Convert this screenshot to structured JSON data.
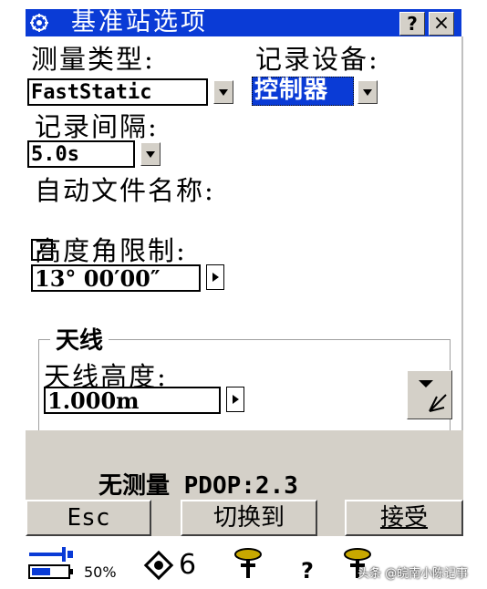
{
  "window": {
    "title": "基准站选项",
    "help_label": "?",
    "close_label": "×"
  },
  "form": {
    "survey_type_label": "测量类型:",
    "survey_type_value": "FastStatic",
    "record_device_label": "记录设备:",
    "record_device_value": "控制器",
    "record_interval_label": "记录间隔:",
    "record_interval_value": "5.0s",
    "auto_filename_label": "自动文件名称:",
    "auto_filename_checked": true,
    "elevation_mask_label": "高度角限制:",
    "elevation_mask_value": "13° 00′00″"
  },
  "antenna": {
    "group_label": "天线",
    "height_label": "天线高度:",
    "height_value": "1.000m"
  },
  "status": {
    "text": "无测量  PDOP:2.3"
  },
  "buttons": {
    "esc": "Esc",
    "switch": "切换到",
    "accept": "接受"
  },
  "statusbar": {
    "battery_percent": "50%",
    "satellites": "6",
    "unknown": "?"
  },
  "watermark": "头条 @皖南小陈记事",
  "colors": {
    "title_bg": "#0a3bd6",
    "panel_gray": "#d4d0c8",
    "selection": "#0a3bd6"
  }
}
